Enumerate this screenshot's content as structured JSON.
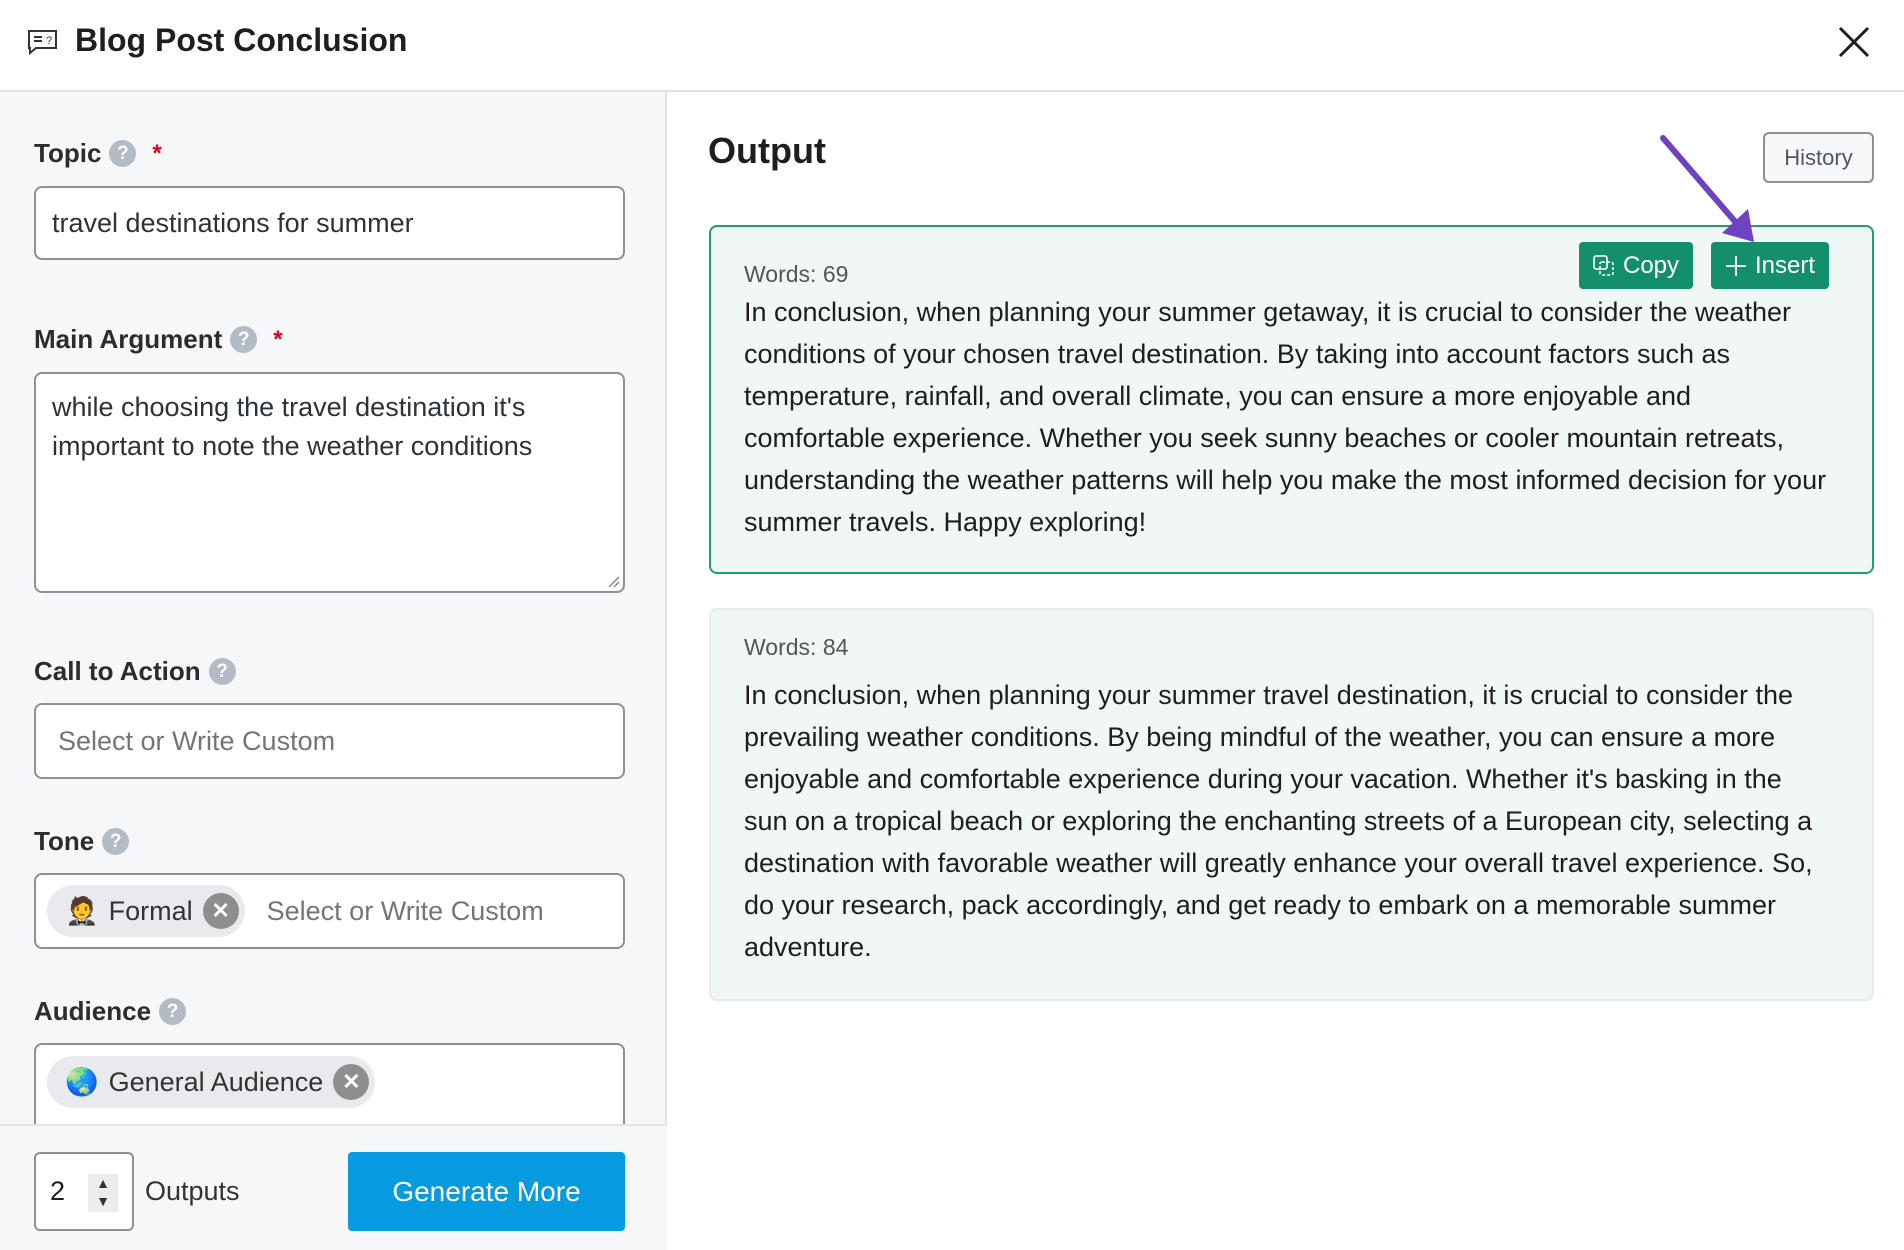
{
  "header": {
    "title": "Blog Post Conclusion",
    "icon": "chat-help-icon"
  },
  "form": {
    "topic": {
      "label": "Topic",
      "required_mark": "*",
      "value": "travel destinations for summer"
    },
    "main_argument": {
      "label": "Main Argument",
      "required_mark": "*",
      "value": "while choosing the travel destination it's important to note the weather conditions"
    },
    "call_to_action": {
      "label": "Call to Action",
      "placeholder": "Select or Write Custom"
    },
    "tone": {
      "label": "Tone",
      "chip": "Formal",
      "chip_emoji": "🤵",
      "placeholder": "Select or Write Custom"
    },
    "audience": {
      "label": "Audience",
      "chip": "General Audience",
      "chip_emoji": "🌏"
    }
  },
  "footer": {
    "outputs_count": "2",
    "outputs_label": "Outputs",
    "generate_label": "Generate More"
  },
  "output": {
    "title": "Output",
    "history_label": "History",
    "copy_label": "Copy",
    "insert_label": "Insert",
    "results": [
      {
        "words": "Words: 69",
        "text": "In conclusion, when planning your summer getaway, it is crucial to consider the weather conditions of your chosen travel destination. By taking into account factors such as temperature, rainfall, and overall climate, you can ensure a more enjoyable and comfortable experience. Whether you seek sunny beaches or cooler mountain retreats, understanding the weather patterns will help you make the most informed decision for your summer travels. Happy exploring!"
      },
      {
        "words": "Words: 84",
        "text": "In conclusion, when planning your summer travel destination, it is crucial to consider the prevailing weather conditions. By being mindful of the weather, you can ensure a more enjoyable and comfortable experience during your vacation. Whether it's basking in the sun on a tropical beach or exploring the enchanting streets of a European city, selecting a destination with favorable weather will greatly enhance your overall travel experience. So, do your research, pack accordingly, and get ready to embark on a memorable summer adventure."
      }
    ]
  },
  "colors": {
    "accent_green": "#148f6b",
    "card_border": "#1e9e75",
    "primary_blue": "#069be0",
    "annotation_arrow": "#6f42c1"
  }
}
